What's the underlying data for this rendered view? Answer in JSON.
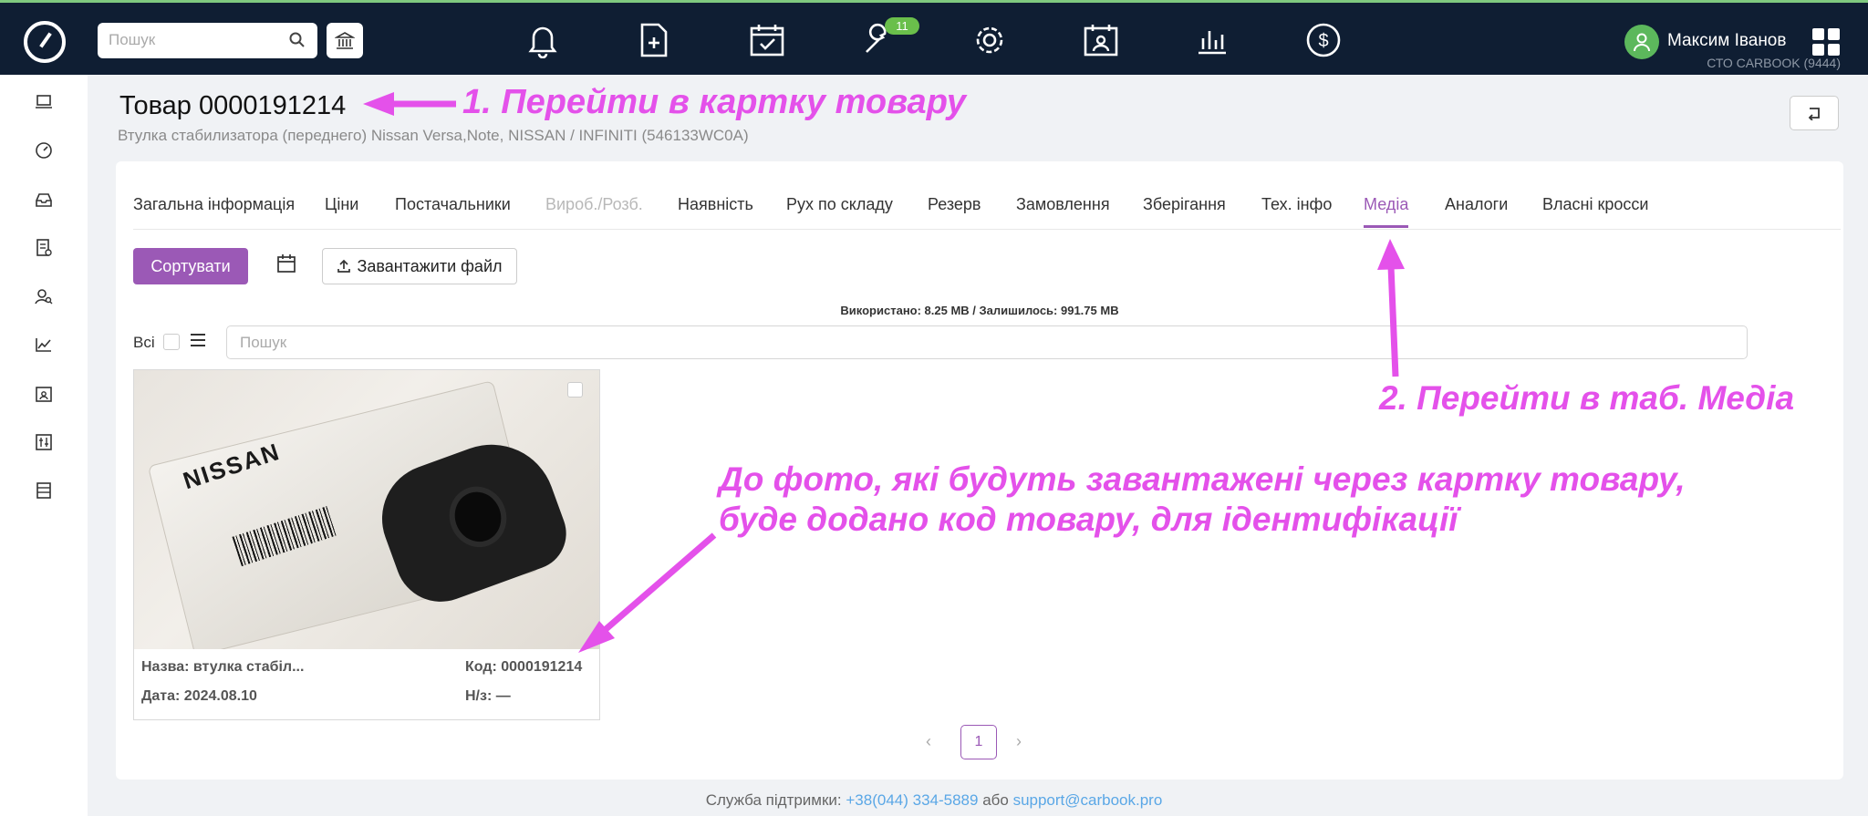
{
  "topbar": {
    "search_placeholder": "Пошук",
    "notif_badge": "11",
    "user_name": "Максим Іванов",
    "user_org": "СТО CARBOOK (9444)"
  },
  "header": {
    "title": "Товар 0000191214",
    "subtitle": "Втулка стабилизатора (переднего) Nissan Versa,Note, NISSAN / INFINITI (546133WC0A)"
  },
  "tabs": [
    "Загальна інформація",
    "Ціни",
    "Постачальники",
    "Вироб./Розб.",
    "Наявність",
    "Рух по складу",
    "Резерв",
    "Замовлення",
    "Зберігання",
    "Тех. інфо",
    "Медіа",
    "Аналоги",
    "Власні кросси"
  ],
  "toolbar": {
    "sort_label": "Сортувати",
    "upload_label": "Завантажити файл",
    "usage_text": "Використано: 8.25 MB / Залишилось: 991.75 MB",
    "all_label": "Всі",
    "search_placeholder": "Пошук"
  },
  "media": {
    "photo_label": "NISSAN",
    "name": "Назва: втулка стабіл...",
    "code": "Код: 0000191214",
    "date": "Дата: 2024.08.10",
    "nz": "Н/з: —"
  },
  "pagination": {
    "current": "1"
  },
  "footer": {
    "prefix": "Служба підтримки: ",
    "phone": "+38(044) 334-5889",
    "middle": " або ",
    "email": "support@carbook.pro"
  },
  "annotations": {
    "step1": "1. Перейти в картку товару",
    "step2": "2. Перейти в таб. Медіа",
    "note_line1": "До фото, які будуть завантажені через картку товару,",
    "note_line2": "буде додано код товару, для ідентифікації"
  },
  "colors": {
    "accent": "#9b59b6",
    "topbar": "#0f1e33",
    "annotation": "#e451ea"
  }
}
